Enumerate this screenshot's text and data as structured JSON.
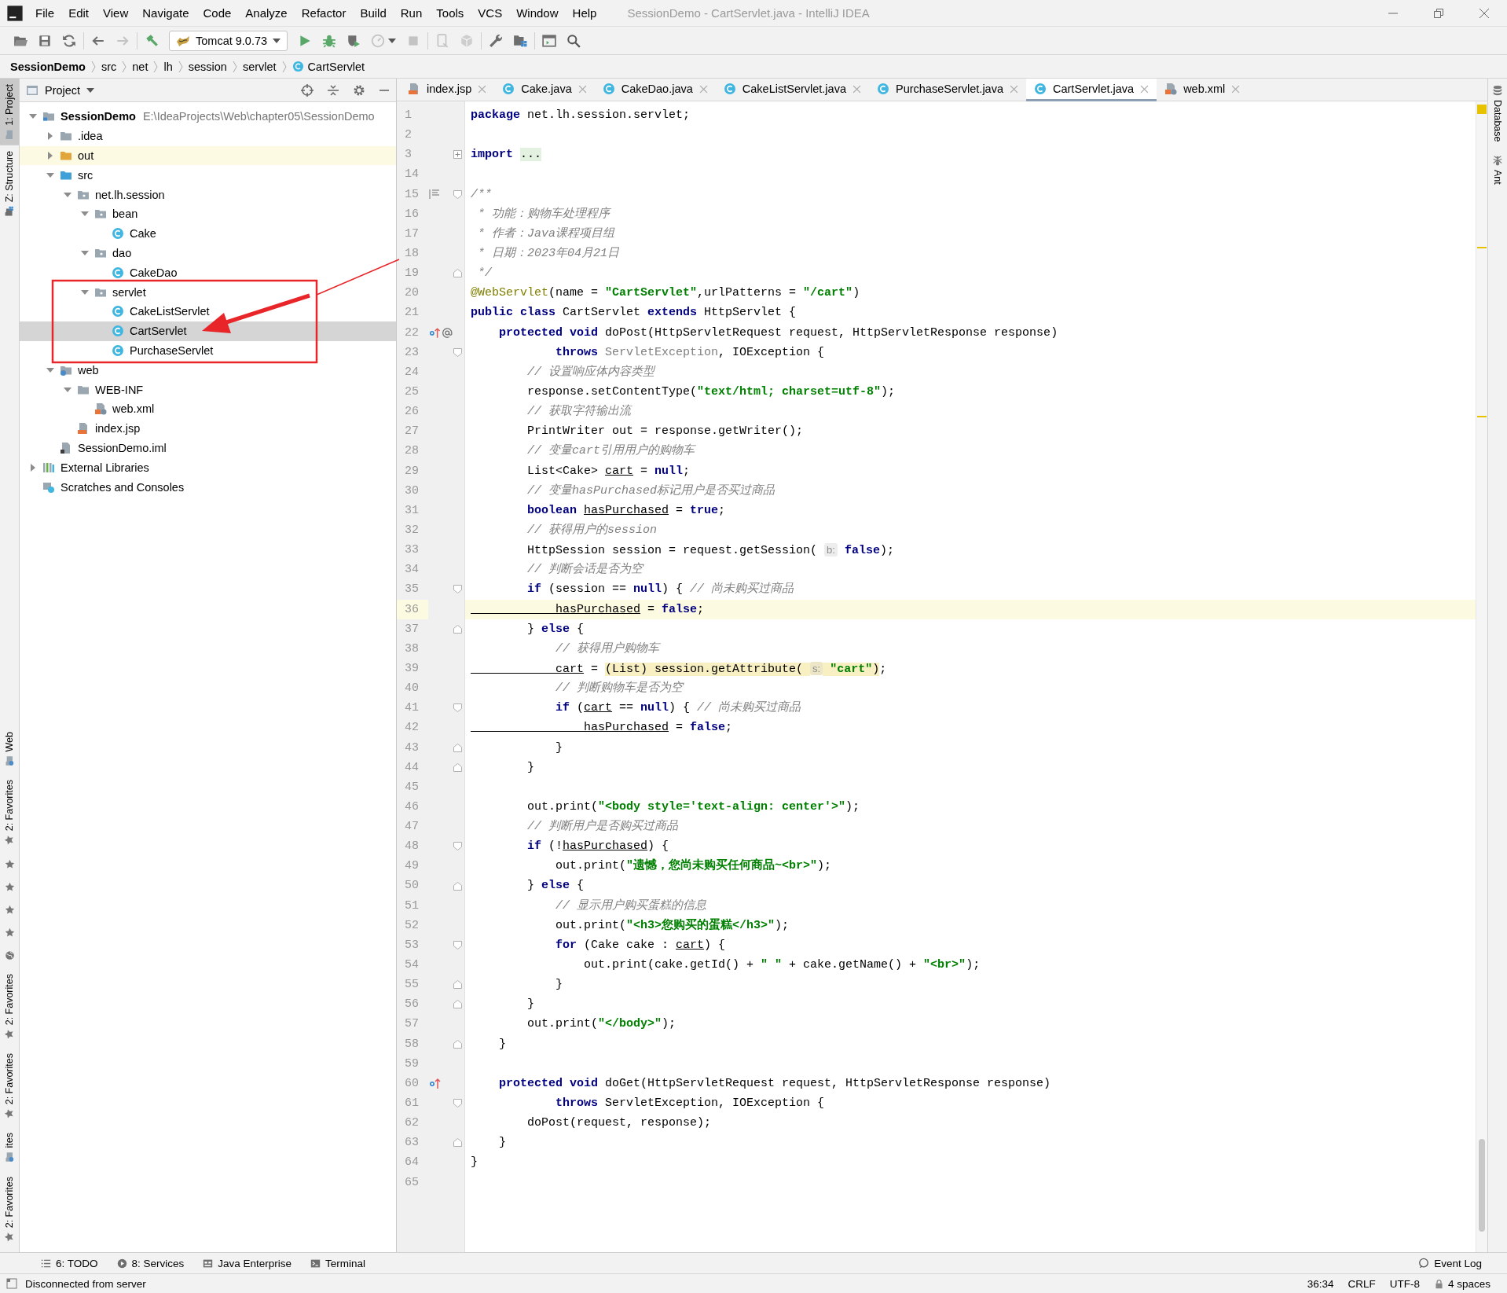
{
  "window": {
    "title": "SessionDemo - CartServlet.java - IntelliJ IDEA"
  },
  "menu": [
    "File",
    "Edit",
    "View",
    "Navigate",
    "Code",
    "Analyze",
    "Refactor",
    "Build",
    "Run",
    "Tools",
    "VCS",
    "Window",
    "Help"
  ],
  "toolbar": {
    "groups": [
      [
        {
          "kind": "open",
          "disabled": false
        },
        {
          "kind": "save",
          "disabled": false
        },
        {
          "kind": "sync",
          "disabled": false
        }
      ],
      [
        {
          "kind": "back",
          "disabled": false
        },
        {
          "kind": "forward",
          "disabled": true
        }
      ],
      [
        {
          "kind": "build",
          "disabled": false
        },
        {
          "kind": "run_config",
          "label": "Tomcat 9.0.73"
        },
        {
          "kind": "run",
          "disabled": false
        },
        {
          "kind": "debug",
          "disabled": false
        },
        {
          "kind": "coverage",
          "disabled": false
        },
        {
          "kind": "profile",
          "disabled": true
        },
        {
          "kind": "stop",
          "disabled": true
        }
      ],
      [
        {
          "kind": "device",
          "disabled": true
        },
        {
          "kind": "cube",
          "disabled": true
        }
      ],
      [
        {
          "kind": "wrench",
          "disabled": false
        },
        {
          "kind": "structure",
          "disabled": false
        }
      ],
      [
        {
          "kind": "frame",
          "disabled": false
        },
        {
          "kind": "search",
          "disabled": false
        }
      ]
    ]
  },
  "breadcrumbs": [
    {
      "label": "SessionDemo"
    },
    {
      "label": "src"
    },
    {
      "label": "net"
    },
    {
      "label": "lh"
    },
    {
      "label": "session"
    },
    {
      "label": "servlet"
    },
    {
      "label": "CartServlet",
      "kind": "class"
    }
  ],
  "left_strip": {
    "top": [
      {
        "label": "1: Project",
        "kind": "project",
        "selected": true
      },
      {
        "label": "Z: Structure",
        "kind": "structure",
        "selected": false
      }
    ],
    "bottom": [
      {
        "kind": "web",
        "label": "Web"
      },
      {
        "kind": "favorites",
        "label": "2: Favorites"
      },
      {
        "kind": "star"
      },
      {
        "kind": "star"
      },
      {
        "kind": "star"
      },
      {
        "kind": "star"
      },
      {
        "kind": "globe"
      },
      {
        "kind": "favorites",
        "label": "2: Favorites"
      },
      {
        "kind": "favorites",
        "label": "2: Favorites"
      },
      {
        "kind": "web",
        "label": "ites"
      },
      {
        "kind": "favorites",
        "label": "2: Favorites"
      }
    ]
  },
  "project": {
    "title": "Project",
    "tree": [
      {
        "label": "SessionDemo",
        "path": "E:\\IdeaProjects\\Web\\chapter05\\SessionDemo",
        "kind": "module",
        "expanded": true,
        "selected": false,
        "children": [
          {
            "label": ".idea",
            "kind": "folder",
            "expanded": false,
            "selected": false
          },
          {
            "label": "out",
            "kind": "excluded",
            "expanded": false,
            "selected": false
          },
          {
            "label": "src",
            "kind": "source",
            "expanded": true,
            "selected": false,
            "children": [
              {
                "label": "net.lh.session",
                "kind": "package",
                "expanded": true,
                "selected": false,
                "children": [
                  {
                    "label": "bean",
                    "kind": "package",
                    "expanded": true,
                    "selected": false,
                    "children": [
                      {
                        "label": "Cake",
                        "kind": "class",
                        "selected": false
                      }
                    ]
                  },
                  {
                    "label": "dao",
                    "kind": "package",
                    "expanded": true,
                    "selected": false,
                    "children": [
                      {
                        "label": "CakeDao",
                        "kind": "class",
                        "selected": false
                      }
                    ]
                  },
                  {
                    "label": "servlet",
                    "kind": "package",
                    "expanded": true,
                    "selected": false,
                    "children": [
                      {
                        "label": "CakeListServlet",
                        "kind": "class",
                        "selected": false
                      },
                      {
                        "label": "CartServlet",
                        "kind": "class",
                        "selected": true
                      },
                      {
                        "label": "PurchaseServlet",
                        "kind": "class",
                        "selected": false
                      }
                    ]
                  }
                ]
              }
            ]
          },
          {
            "label": "web",
            "kind": "web",
            "expanded": true,
            "selected": false,
            "children": [
              {
                "label": "WEB-INF",
                "kind": "folder",
                "expanded": true,
                "selected": false,
                "children": [
                  {
                    "label": "web.xml",
                    "kind": "xml",
                    "selected": false
                  }
                ]
              },
              {
                "label": "index.jsp",
                "kind": "jsp",
                "selected": false
              }
            ]
          },
          {
            "label": "SessionDemo.iml",
            "kind": "iml",
            "selected": false
          }
        ]
      },
      {
        "label": "External Libraries",
        "kind": "libraries",
        "expanded": false,
        "selected": false
      },
      {
        "label": "Scratches and Consoles",
        "kind": "scratches",
        "selected": false
      }
    ]
  },
  "tabs": [
    {
      "label": "index.jsp",
      "kind": "jsp",
      "selected": false
    },
    {
      "label": "Cake.java",
      "kind": "class",
      "selected": false
    },
    {
      "label": "CakeDao.java",
      "kind": "class",
      "selected": false
    },
    {
      "label": "CakeListServlet.java",
      "kind": "class",
      "selected": false
    },
    {
      "label": "PurchaseServlet.java",
      "kind": "class",
      "selected": false
    },
    {
      "label": "CartServlet.java",
      "kind": "class",
      "selected": true
    },
    {
      "label": "web.xml",
      "kind": "xml",
      "selected": false
    }
  ],
  "code": {
    "lines": [
      {
        "n": "1",
        "current": false,
        "tokens": [
          {
            "kind": "kw",
            "text": "package"
          },
          {
            "kind": "plain",
            "text": " net.lh.session.servlet;"
          }
        ]
      },
      {
        "n": "2",
        "current": false
      },
      {
        "n": "3",
        "current": false,
        "tokens": [
          {
            "kind": "kw",
            "text": "import "
          },
          {
            "kind": "folded",
            "text": "..."
          }
        ]
      },
      {
        "n": "14",
        "current": false
      },
      {
        "n": "15",
        "current": false,
        "tokens": [
          {
            "kind": "comment",
            "text": "/**"
          }
        ]
      },
      {
        "n": "16",
        "current": false,
        "tokens": [
          {
            "kind": "comment",
            "text": " * 功能：购物车处理程序"
          }
        ]
      },
      {
        "n": "17",
        "current": false,
        "tokens": [
          {
            "kind": "comment",
            "text": " * 作者：Java课程项目组"
          }
        ]
      },
      {
        "n": "18",
        "current": false,
        "tokens": [
          {
            "kind": "comment",
            "text": " * 日期：2023年04月21日"
          }
        ]
      },
      {
        "n": "19",
        "current": false,
        "tokens": [
          {
            "kind": "comment",
            "text": " */"
          }
        ]
      },
      {
        "n": "20",
        "current": false,
        "tokens": [
          {
            "kind": "ann",
            "text": "@WebServlet"
          },
          {
            "kind": "plain",
            "text": "(name = "
          },
          {
            "kind": "str",
            "text": "\"CartServlet\""
          },
          {
            "kind": "plain",
            "text": ",urlPatterns = "
          },
          {
            "kind": "str",
            "text": "\"/cart\""
          },
          {
            "kind": "plain",
            "text": ")"
          }
        ]
      },
      {
        "n": "21",
        "current": false,
        "tokens": [
          {
            "kind": "kw",
            "text": "public class"
          },
          {
            "kind": "plain",
            "text": " CartServlet "
          },
          {
            "kind": "kw",
            "text": "extends"
          },
          {
            "kind": "plain",
            "text": " HttpServlet {"
          }
        ]
      },
      {
        "n": "22",
        "current": false,
        "tokens": [
          {
            "kind": "kw",
            "text": "    protected void"
          },
          {
            "kind": "plain",
            "text": " doPost(HttpServletRequest request, HttpServletResponse response)"
          }
        ]
      },
      {
        "n": "23",
        "current": false,
        "tokens": [
          {
            "kind": "kw",
            "text": "            throws "
          },
          {
            "kind": "grey",
            "text": "ServletException"
          },
          {
            "kind": "plain",
            "text": ", IOException {"
          }
        ]
      },
      {
        "n": "24",
        "current": false,
        "tokens": [
          {
            "kind": "comment",
            "text": "        // 设置响应体内容类型"
          }
        ]
      },
      {
        "n": "25",
        "current": false,
        "tokens": [
          {
            "kind": "plain",
            "text": "        response.setContentType("
          },
          {
            "kind": "str",
            "text": "\"text/html; charset=utf-8\""
          },
          {
            "kind": "plain",
            "text": ");"
          }
        ]
      },
      {
        "n": "26",
        "current": false,
        "tokens": [
          {
            "kind": "comment",
            "text": "        // 获取字符输出流"
          }
        ]
      },
      {
        "n": "27",
        "current": false,
        "tokens": [
          {
            "kind": "plain",
            "text": "        PrintWriter out = response.getWriter();"
          }
        ]
      },
      {
        "n": "28",
        "current": false,
        "tokens": [
          {
            "kind": "comment",
            "text": "        // 变量cart引用用户的购物车"
          }
        ]
      },
      {
        "n": "29",
        "current": false,
        "tokens": [
          {
            "kind": "plain",
            "text": "        List<Cake> "
          },
          {
            "kind": "field",
            "text": "cart"
          },
          {
            "kind": "plain",
            "text": " = "
          },
          {
            "kind": "kw",
            "text": "null"
          },
          {
            "kind": "plain",
            "text": ";"
          }
        ]
      },
      {
        "n": "30",
        "current": false,
        "tokens": [
          {
            "kind": "comment",
            "text": "        // 变量hasPurchased标记用户是否买过商品"
          }
        ]
      },
      {
        "n": "31",
        "current": false,
        "tokens": [
          {
            "kind": "kw",
            "text": "        boolean "
          },
          {
            "kind": "field",
            "text": "hasPurchased"
          },
          {
            "kind": "plain",
            "text": " = "
          },
          {
            "kind": "kw",
            "text": "true"
          },
          {
            "kind": "plain",
            "text": ";"
          }
        ]
      },
      {
        "n": "32",
        "current": false,
        "tokens": [
          {
            "kind": "comment",
            "text": "        // 获得用户的session"
          }
        ]
      },
      {
        "n": "33",
        "current": false,
        "tokens": [
          {
            "kind": "plain",
            "text": "        HttpSession session = request.getSession( "
          },
          {
            "kind": "hint",
            "text": "b:"
          },
          {
            "kind": "kw",
            "text": " false"
          },
          {
            "kind": "plain",
            "text": ");"
          }
        ]
      },
      {
        "n": "34",
        "current": false,
        "tokens": [
          {
            "kind": "comment",
            "text": "        // 判断会话是否为空"
          }
        ]
      },
      {
        "n": "35",
        "current": false,
        "tokens": [
          {
            "kind": "kw",
            "text": "        if"
          },
          {
            "kind": "plain",
            "text": " (session == "
          },
          {
            "kind": "kw",
            "text": "null"
          },
          {
            "kind": "plain",
            "text": ") { "
          },
          {
            "kind": "comment",
            "text": "// 尚未购买过商品"
          }
        ]
      },
      {
        "n": "36",
        "current": true,
        "tokens": [
          {
            "kind": "field",
            "text": "            hasPurchased"
          },
          {
            "kind": "plain",
            "text": " = "
          },
          {
            "kind": "kw",
            "text": "false"
          },
          {
            "kind": "plain",
            "text": ";"
          }
        ]
      },
      {
        "n": "37",
        "current": false,
        "tokens": [
          {
            "kind": "plain",
            "text": "        } "
          },
          {
            "kind": "kw",
            "text": "else"
          },
          {
            "kind": "plain",
            "text": " {"
          }
        ]
      },
      {
        "n": "38",
        "current": false,
        "tokens": [
          {
            "kind": "comment",
            "text": "            // 获得用户购物车"
          }
        ]
      },
      {
        "n": "39",
        "current": false,
        "tokens": [
          {
            "kind": "field",
            "text": "            cart"
          },
          {
            "kind": "plain",
            "text": " = "
          },
          {
            "kind": "hl-plain",
            "text": "(List) session.getAttribute( "
          },
          {
            "kind": "hl-hint",
            "text": "s:"
          },
          {
            "kind": "hl-str",
            "text": " \"cart\""
          },
          {
            "kind": "hl-plain",
            "text": ")"
          },
          {
            "kind": "plain",
            "text": ";"
          }
        ]
      },
      {
        "n": "40",
        "current": false,
        "tokens": [
          {
            "kind": "comment",
            "text": "            // 判断购物车是否为空"
          }
        ]
      },
      {
        "n": "41",
        "current": false,
        "tokens": [
          {
            "kind": "kw",
            "text": "            if"
          },
          {
            "kind": "plain",
            "text": " ("
          },
          {
            "kind": "field",
            "text": "cart"
          },
          {
            "kind": "plain",
            "text": " == "
          },
          {
            "kind": "kw",
            "text": "null"
          },
          {
            "kind": "plain",
            "text": ") { "
          },
          {
            "kind": "comment",
            "text": "// 尚未购买过商品"
          }
        ]
      },
      {
        "n": "42",
        "current": false,
        "tokens": [
          {
            "kind": "field",
            "text": "                hasPurchased"
          },
          {
            "kind": "plain",
            "text": " = "
          },
          {
            "kind": "kw",
            "text": "false"
          },
          {
            "kind": "plain",
            "text": ";"
          }
        ]
      },
      {
        "n": "43",
        "current": false,
        "tokens": [
          {
            "kind": "plain",
            "text": "            }"
          }
        ]
      },
      {
        "n": "44",
        "current": false,
        "tokens": [
          {
            "kind": "plain",
            "text": "        }"
          }
        ]
      },
      {
        "n": "45",
        "current": false
      },
      {
        "n": "46",
        "current": false,
        "tokens": [
          {
            "kind": "plain",
            "text": "        out.print("
          },
          {
            "kind": "str",
            "text": "\"<body style='text-align: center'>\""
          },
          {
            "kind": "plain",
            "text": ");"
          }
        ]
      },
      {
        "n": "47",
        "current": false,
        "tokens": [
          {
            "kind": "comment",
            "text": "        // 判断用户是否购买过商品"
          }
        ]
      },
      {
        "n": "48",
        "current": false,
        "tokens": [
          {
            "kind": "kw",
            "text": "        if"
          },
          {
            "kind": "plain",
            "text": " (!"
          },
          {
            "kind": "field",
            "text": "hasPurchased"
          },
          {
            "kind": "plain",
            "text": ") {"
          }
        ]
      },
      {
        "n": "49",
        "current": false,
        "tokens": [
          {
            "kind": "plain",
            "text": "            out.print("
          },
          {
            "kind": "str",
            "text": "\"遗憾，您尚未购买任何商品~<br>\""
          },
          {
            "kind": "plain",
            "text": ");"
          }
        ]
      },
      {
        "n": "50",
        "current": false,
        "tokens": [
          {
            "kind": "plain",
            "text": "        } "
          },
          {
            "kind": "kw",
            "text": "else"
          },
          {
            "kind": "plain",
            "text": " {"
          }
        ]
      },
      {
        "n": "51",
        "current": false,
        "tokens": [
          {
            "kind": "comment",
            "text": "            // 显示用户购买蛋糕的信息"
          }
        ]
      },
      {
        "n": "52",
        "current": false,
        "tokens": [
          {
            "kind": "plain",
            "text": "            out.print("
          },
          {
            "kind": "str",
            "text": "\"<h3>您购买的蛋糕</h3>\""
          },
          {
            "kind": "plain",
            "text": ");"
          }
        ]
      },
      {
        "n": "53",
        "current": false,
        "tokens": [
          {
            "kind": "kw",
            "text": "            for"
          },
          {
            "kind": "plain",
            "text": " (Cake cake : "
          },
          {
            "kind": "field",
            "text": "cart"
          },
          {
            "kind": "plain",
            "text": ") {"
          }
        ]
      },
      {
        "n": "54",
        "current": false,
        "tokens": [
          {
            "kind": "plain",
            "text": "                out.print(cake.getId() + "
          },
          {
            "kind": "str",
            "text": "\" \""
          },
          {
            "kind": "plain",
            "text": " + cake.getName() + "
          },
          {
            "kind": "str",
            "text": "\"<br>\""
          },
          {
            "kind": "plain",
            "text": ");"
          }
        ]
      },
      {
        "n": "55",
        "current": false,
        "tokens": [
          {
            "kind": "plain",
            "text": "            }"
          }
        ]
      },
      {
        "n": "56",
        "current": false,
        "tokens": [
          {
            "kind": "plain",
            "text": "        }"
          }
        ]
      },
      {
        "n": "57",
        "current": false,
        "tokens": [
          {
            "kind": "plain",
            "text": "        out.print("
          },
          {
            "kind": "str",
            "text": "\"</body>\""
          },
          {
            "kind": "plain",
            "text": ");"
          }
        ]
      },
      {
        "n": "58",
        "current": false,
        "tokens": [
          {
            "kind": "plain",
            "text": "    }"
          }
        ]
      },
      {
        "n": "59",
        "current": false
      },
      {
        "n": "60",
        "current": false,
        "tokens": [
          {
            "kind": "kw",
            "text": "    protected void"
          },
          {
            "kind": "plain",
            "text": " doGet(HttpServletRequest request, HttpServletResponse response)"
          }
        ]
      },
      {
        "n": "61",
        "current": false,
        "tokens": [
          {
            "kind": "kw",
            "text": "            throws"
          },
          {
            "kind": "plain",
            "text": " ServletException, IOException {"
          }
        ]
      },
      {
        "n": "62",
        "current": false,
        "tokens": [
          {
            "kind": "plain",
            "text": "        doPost(request, response);"
          }
        ]
      },
      {
        "n": "63",
        "current": false,
        "tokens": [
          {
            "kind": "plain",
            "text": "    }"
          }
        ]
      },
      {
        "n": "64",
        "current": false,
        "tokens": [
          {
            "kind": "plain",
            "text": "}"
          }
        ]
      },
      {
        "n": "65",
        "current": false
      }
    ]
  },
  "right_strip": [
    {
      "label": "Database",
      "kind": "database"
    },
    {
      "label": "Ant",
      "kind": "ant"
    }
  ],
  "tool_tabs": {
    "left": [
      {
        "label": "6: TODO",
        "kind": "todo"
      },
      {
        "label": "8: Services",
        "kind": "services"
      },
      {
        "label": "Java Enterprise",
        "kind": "enterprise"
      },
      {
        "label": "Terminal",
        "kind": "terminal"
      }
    ],
    "right": [
      {
        "label": "Event Log",
        "kind": "eventlog"
      }
    ]
  },
  "status_bar": {
    "message": "Disconnected from server",
    "items": [
      {
        "label": "36:34"
      },
      {
        "label": "CRLF"
      },
      {
        "label": "UTF-8"
      },
      {
        "label": "4 spaces",
        "kind": "lock"
      }
    ]
  }
}
